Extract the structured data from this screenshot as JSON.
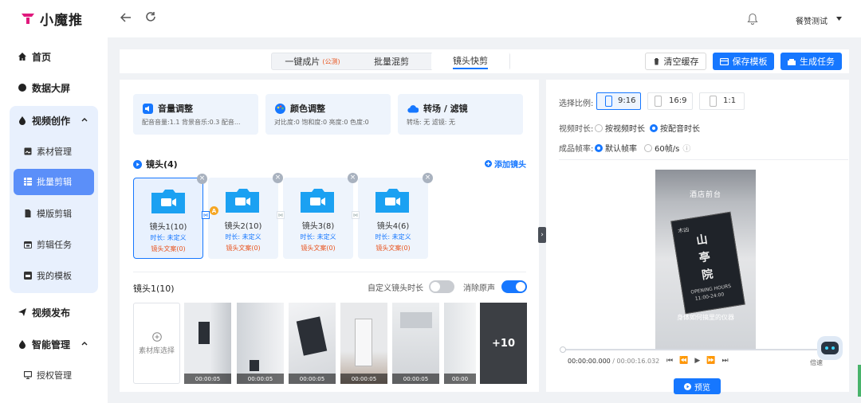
{
  "app": {
    "name": "小魔推"
  },
  "user": {
    "name": "餐赞测试"
  },
  "sidebar": {
    "items": [
      {
        "label": "首页"
      },
      {
        "label": "数据大屏"
      },
      {
        "label": "视频创作"
      },
      {
        "label": "素材管理"
      },
      {
        "label": "批量剪辑"
      },
      {
        "label": "模版剪辑"
      },
      {
        "label": "剪辑任务"
      },
      {
        "label": "我的模板"
      },
      {
        "label": "视频发布"
      },
      {
        "label": "智能管理"
      },
      {
        "label": "授权管理"
      }
    ]
  },
  "modes": {
    "one_click": "一键成片",
    "one_click_tag": "(公测)",
    "batch_mix": "批量混剪",
    "shot_quick": "镜头快剪"
  },
  "actions": {
    "clear_cache": "清空缓存",
    "save_template": "保存模板",
    "generate_task": "生成任务"
  },
  "settings_cards": [
    {
      "title": "音量调整",
      "desc": "配音音量:1.1 背景音乐:0.3 配音..."
    },
    {
      "title": "颜色调整",
      "desc": "对比度:0 饱和度:0 亮度:0 色度:0"
    },
    {
      "title": "转场 / 滤镜",
      "desc": "转场: 无 滤镜: 无"
    }
  ],
  "shots_section": {
    "title": "镜头(4)",
    "add_label": "添加镜头",
    "shots": [
      {
        "name": "镜头1(10)",
        "duration": "时长: 未定义",
        "copy": "镜头文案(0)"
      },
      {
        "name": "镜头2(10)",
        "duration": "时长: 未定义",
        "copy": "镜头文案(0)"
      },
      {
        "name": "镜头3(8)",
        "duration": "时长: 未定义",
        "copy": "镜头文案(0)"
      },
      {
        "name": "镜头4(6)",
        "duration": "时长: 未定义",
        "copy": "镜头文案(0)"
      }
    ],
    "transition_badge": "A"
  },
  "shot_detail": {
    "title": "镜头1(10)",
    "custom_duration_label": "自定义镜头时长",
    "custom_duration_on": false,
    "mute_label": "消除原声",
    "mute_on": true,
    "library_label": "素材库选择",
    "clips": [
      "00:00:05",
      "00:00:05",
      "00:00:05",
      "00:00:05",
      "00:00:05",
      "00:00"
    ],
    "more_label": "+10"
  },
  "preview_settings": {
    "ratio_label": "选择比例:",
    "ratios": [
      "9:16",
      "16:9",
      "1:1"
    ],
    "selected_ratio": "9:16",
    "duration_label": "视频时长:",
    "duration_options": [
      "按视频时长",
      "按配音时长"
    ],
    "duration_selected": "按配音时长",
    "fps_label": "成品帧率:",
    "fps_options": [
      "默认帧率",
      "60帧/s"
    ],
    "fps_selected": "默认帧率"
  },
  "preview": {
    "current_time": "00:00:00.000",
    "total_time": "00:00:16.032",
    "speed_label": "倍速",
    "preview_button": "预览",
    "video_texts": {
      "top": "酒店前台",
      "sign_small": "木凶",
      "sign_big1": "山",
      "sign_big2": "亭",
      "sign_big3": "院",
      "opening": "OPENING HOURS",
      "hours": "11:00-24:00",
      "subtitle": "身体如何搞里的仪器"
    }
  },
  "colors": {
    "primary": "#1677ff",
    "accent_orange": "#e8541f",
    "sidebar_active": "#5b8ff9",
    "sidebar_group_bg": "#e8f0fd",
    "card_bg": "#eef4fc"
  }
}
